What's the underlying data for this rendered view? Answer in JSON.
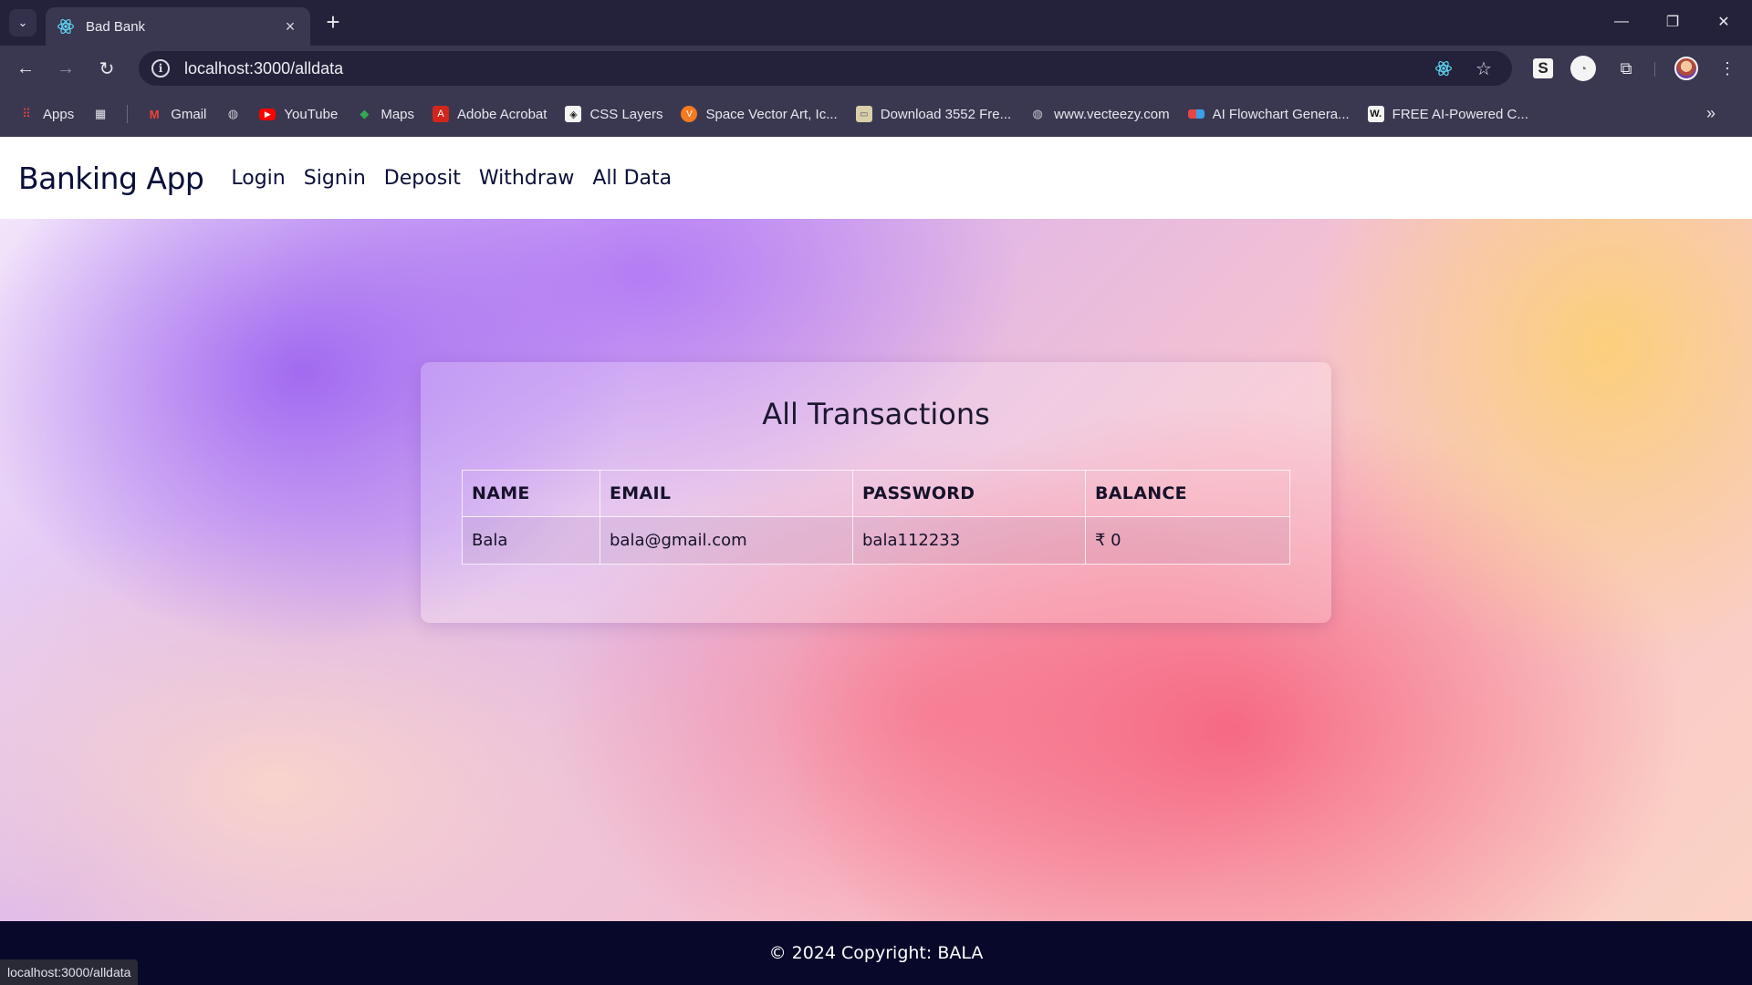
{
  "browser": {
    "tab_title": "Bad Bank",
    "url": "localhost:3000/alldata",
    "bookmarks": [
      {
        "label": "Apps",
        "icon": "apps-grid-icon"
      },
      {
        "label": "Gmail",
        "icon": "gmail-icon"
      },
      {
        "label": "YouTube",
        "icon": "youtube-icon"
      },
      {
        "label": "Maps",
        "icon": "maps-icon"
      },
      {
        "label": "Adobe Acrobat",
        "icon": "acrobat-icon"
      },
      {
        "label": "CSS Layers",
        "icon": "css-layers-icon"
      },
      {
        "label": "Space Vector Art, Ic...",
        "icon": "vecteezy-icon"
      },
      {
        "label": "Download 3552 Fre...",
        "icon": "image-icon"
      },
      {
        "label": "www.vecteezy.com",
        "icon": "globe-icon"
      },
      {
        "label": "AI Flowchart Genera...",
        "icon": "flowchart-icon"
      },
      {
        "label": "FREE AI-Powered C...",
        "icon": "w-icon"
      }
    ],
    "status_text": "localhost:3000/alldata"
  },
  "navbar": {
    "brand": "Banking App",
    "links": [
      "Login",
      "Signin",
      "Deposit",
      "Withdraw",
      "All Data"
    ]
  },
  "card": {
    "title": "All Transactions",
    "columns": [
      "NAME",
      "EMAIL",
      "PASSWORD",
      "BALANCE"
    ],
    "rows": [
      [
        "Bala",
        "bala@gmail.com",
        "bala112233",
        "₹ 0"
      ]
    ]
  },
  "footer": {
    "text": "© 2024 Copyright: BALA"
  },
  "colors": {
    "chrome_dark": "#24223a",
    "chrome_mid": "#3a3850",
    "nav_text": "#0a0f3a",
    "footer_bg": "#08082a"
  }
}
